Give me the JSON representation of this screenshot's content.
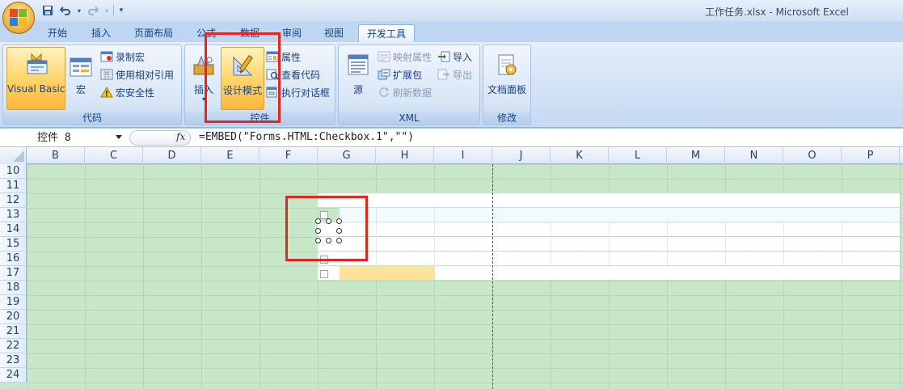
{
  "window": {
    "title": "工作任务.xlsx - Microsoft Excel"
  },
  "qat": {
    "save_icon": "save-icon",
    "undo_icon": "undo-icon",
    "redo_icon": "redo-icon",
    "customize_icon": "customize-qat-icon"
  },
  "tabs": [
    {
      "label": "开始"
    },
    {
      "label": "插入"
    },
    {
      "label": "页面布局"
    },
    {
      "label": "公式"
    },
    {
      "label": "数据"
    },
    {
      "label": "审阅"
    },
    {
      "label": "视图"
    },
    {
      "label": "开发工具",
      "active": true
    }
  ],
  "ribbon": {
    "code_group": {
      "label": "代码",
      "visual_basic": "Visual Basic",
      "macros": "宏",
      "record_macro": "录制宏",
      "relative_ref": "使用相对引用",
      "macro_security": "宏安全性"
    },
    "controls_group": {
      "label": "控件",
      "insert": "插入",
      "design_mode": "设计模式",
      "properties": "属性",
      "view_code": "查看代码",
      "run_dialog": "执行对话框"
    },
    "xml_group": {
      "label": "XML",
      "source": "源",
      "map_properties": "映射属性",
      "expansion_packs": "扩展包",
      "refresh_data": "刷新数据",
      "import": "导入",
      "export": "导出"
    },
    "modify_group": {
      "label": "修改",
      "document_panel": "文档面板"
    }
  },
  "formula_bar": {
    "name_box": "控件 8",
    "fx": "fx",
    "formula": "=EMBED(\"Forms.HTML:Checkbox.1\",\"\")"
  },
  "grid": {
    "columns": [
      "B",
      "C",
      "D",
      "E",
      "F",
      "G",
      "H",
      "I",
      "J",
      "K",
      "L",
      "M",
      "N",
      "O",
      "P"
    ],
    "rows": [
      "10",
      "11",
      "12",
      "13",
      "14",
      "15",
      "16",
      "17",
      "18",
      "19",
      "20",
      "21",
      "22",
      "23",
      "24"
    ]
  },
  "colors": {
    "accent_red": "#e3261f",
    "sheet_green": "#c7e8c8",
    "highlight_yellow": "#fde29a"
  }
}
